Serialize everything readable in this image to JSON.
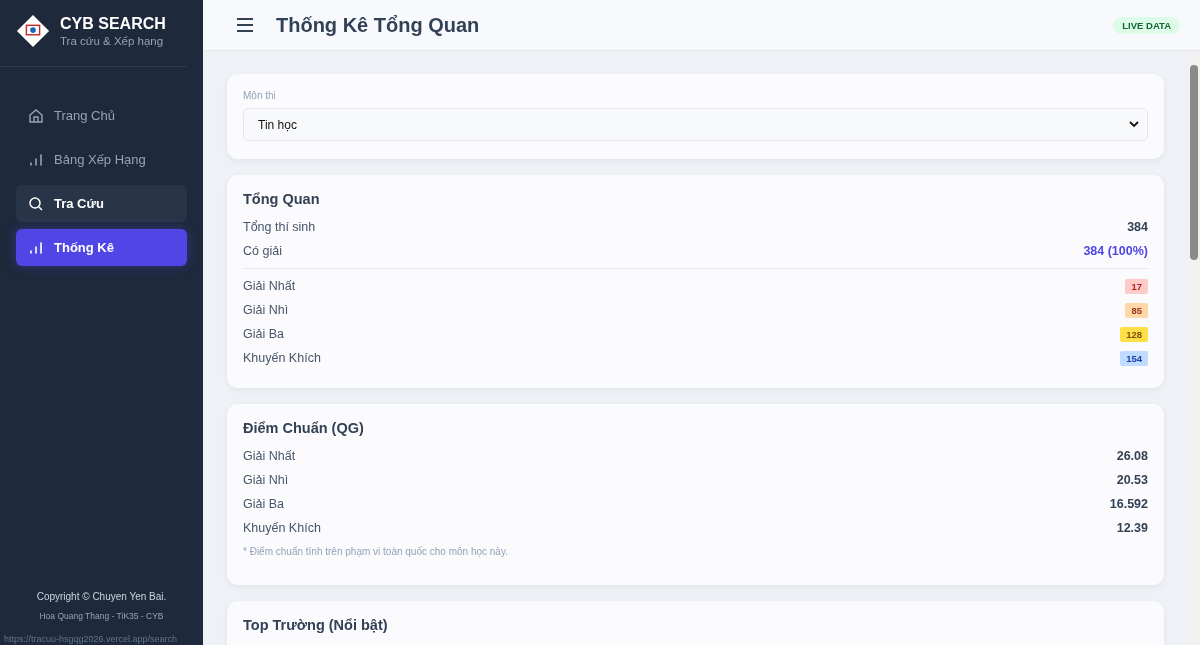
{
  "sidebar": {
    "brand": {
      "title": "CYB SEARCH",
      "subtitle": "Tra cứu & Xếp hạng"
    },
    "items": [
      {
        "label": "Trang Chủ",
        "kind": "home",
        "selected": false,
        "hovered": false
      },
      {
        "label": "Bảng Xếp Hạng",
        "kind": "chart",
        "selected": false,
        "hovered": false
      },
      {
        "label": "Tra Cứu",
        "kind": "search",
        "selected": false,
        "hovered": true
      },
      {
        "label": "Thống Kê",
        "kind": "chart",
        "selected": true,
        "hovered": false
      }
    ],
    "footer": [
      "Copyright © Chuyen Yen Bai.",
      "Hoa Quang Thang - TiK35 - CYB"
    ]
  },
  "status_url": "https://tracuu-hsgqg2026.vercel.app/search",
  "header": {
    "title": "Thống Kê Tổng Quan",
    "badge": "LIVE DATA"
  },
  "subject": {
    "label": "Môn thi",
    "value": "Tin học"
  },
  "overview": {
    "title": "Tổng Quan",
    "stats": [
      {
        "label": "Tổng thí sinh",
        "value": "384",
        "accent": false
      },
      {
        "label": "Có giải",
        "value": "384 (100%)",
        "accent": true
      }
    ],
    "prizes": [
      {
        "label": "Giải Nhất",
        "count": "17",
        "color": "#fecaca"
      },
      {
        "label": "Giải Nhì",
        "count": "85",
        "color": "#fed7aa"
      },
      {
        "label": "Giải Ba",
        "count": "128",
        "color": "#fde047"
      },
      {
        "label": "Khuyến Khích",
        "count": "154",
        "color": "#bfdbfe"
      }
    ]
  },
  "cutoff": {
    "title": "Điểm Chuẩn (QG)",
    "rows": [
      {
        "label": "Giải Nhất",
        "value": "26.08"
      },
      {
        "label": "Giải Nhì",
        "value": "20.53"
      },
      {
        "label": "Giải Ba",
        "value": "16.592"
      },
      {
        "label": "Khuyến Khích",
        "value": "12.39"
      }
    ],
    "note": "* Điểm chuẩn tính trên phạm vi toàn quốc cho môn học này."
  },
  "top_schools": {
    "title": "Top Trường (Nổi bật)"
  }
}
